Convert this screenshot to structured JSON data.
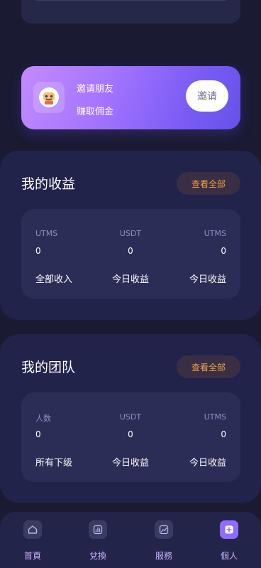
{
  "invite": {
    "line1": "邀请朋友",
    "line2": "赚取佣金",
    "button": "邀请"
  },
  "earnings": {
    "title": "我的收益",
    "view_all": "查看全部",
    "columns": [
      {
        "label": "UTMS",
        "value": "0",
        "caption": "全部收入"
      },
      {
        "label": "USDT",
        "value": "0",
        "caption": "今日收益"
      },
      {
        "label": "UTMS",
        "value": "0",
        "caption": "今日收益"
      }
    ]
  },
  "team": {
    "title": "我的团队",
    "view_all": "查看全部",
    "columns": [
      {
        "label": "人数",
        "value": "0",
        "caption": "所有下级"
      },
      {
        "label": "USDT",
        "value": "0",
        "caption": "今日收益"
      },
      {
        "label": "UTMS",
        "value": "0",
        "caption": "今日收益"
      }
    ]
  },
  "tabbar": {
    "items": [
      {
        "label": "首頁",
        "icon": "home-icon"
      },
      {
        "label": "兌換",
        "icon": "exchange-chart-icon"
      },
      {
        "label": "服務",
        "icon": "service-trend-icon"
      },
      {
        "label": "個人",
        "icon": "profile-plus-icon",
        "active": true
      }
    ]
  },
  "colors": {
    "background": "#1a1a33",
    "panel": "#22234a",
    "accent_orange": "#f0a045",
    "accent_purple": "#8f6cff"
  }
}
